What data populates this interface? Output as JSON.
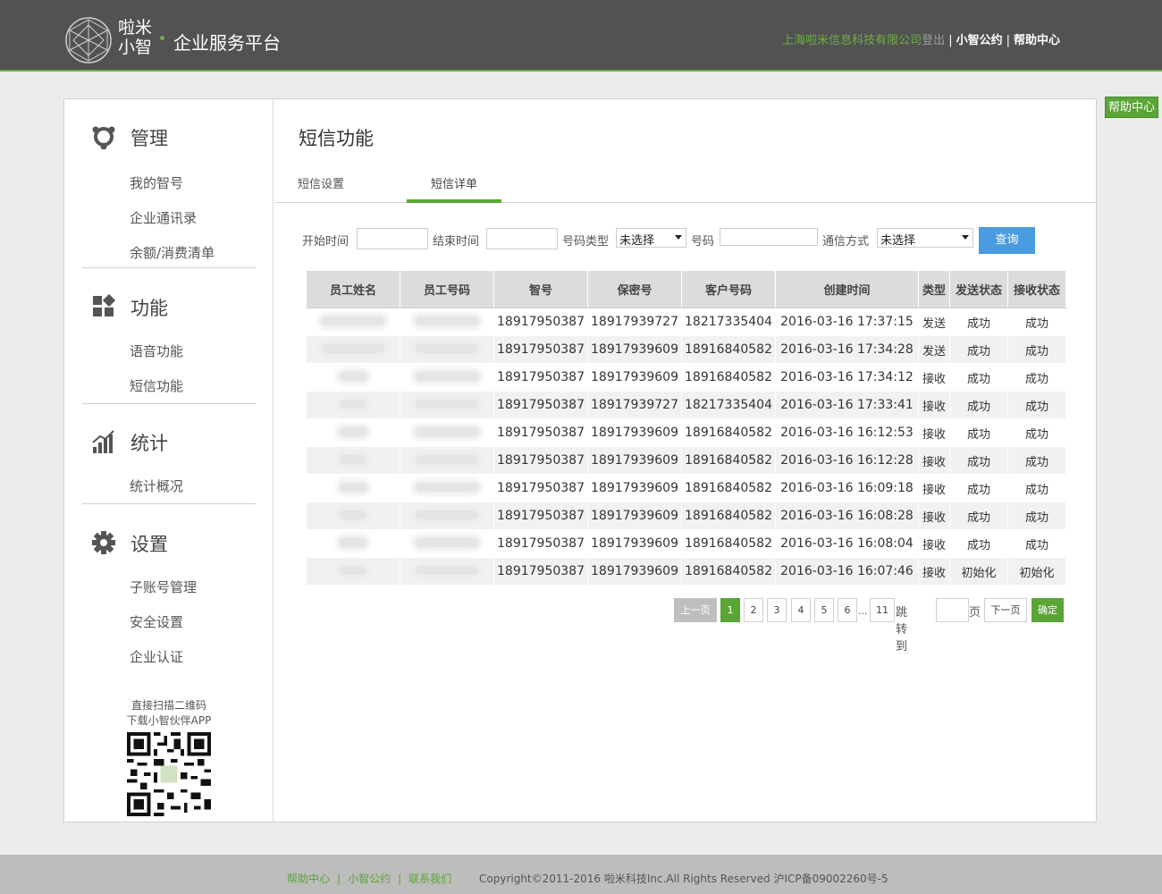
{
  "header": {
    "brand_line1": "啦米",
    "brand_line2": "小智",
    "platform": "企业服务平台",
    "company": "上海啦米信息科技有限公司",
    "logout": "登出",
    "sep": "|",
    "link_agreement": "小智公约",
    "link_help": "帮助中心",
    "accent_color": "#6fae45"
  },
  "float_help": "帮助中心",
  "sidebar": {
    "sections": [
      {
        "title": "管理",
        "icon": "manage-icon",
        "items": [
          "我的智号",
          "企业通讯录",
          "余额/消费清单"
        ]
      },
      {
        "title": "功能",
        "icon": "function-icon",
        "items": [
          "语音功能",
          "短信功能"
        ]
      },
      {
        "title": "统计",
        "icon": "stats-icon",
        "items": [
          "统计概况"
        ]
      },
      {
        "title": "设置",
        "icon": "settings-gear-icon",
        "items": [
          "子账号管理",
          "安全设置",
          "企业认证"
        ]
      }
    ],
    "qr_line1": "直接扫描二维码",
    "qr_line2": "下载小智伙伴APP"
  },
  "content": {
    "title": "短信功能",
    "tabs": [
      {
        "label": "短信设置",
        "active": false
      },
      {
        "label": "短信详单",
        "active": true
      }
    ]
  },
  "filters": {
    "start_label": "开始时间",
    "start_value": "",
    "end_label": "结束时间",
    "end_value": "",
    "num_type_label": "号码类型",
    "num_type_value": "未选择",
    "num_label": "号码",
    "num_value": "",
    "comm_label": "通信方式",
    "comm_value": "未选择",
    "query_label": "查询"
  },
  "table": {
    "columns": [
      "员工姓名",
      "员工号码",
      "智号",
      "保密号",
      "客户号码",
      "创建时间",
      "类型",
      "发送状态",
      "接收状态"
    ],
    "rows": [
      [
        "",
        "",
        "18917950387",
        "18917939727",
        "18217335404",
        "2016-03-16 17:37:15",
        "发送",
        "成功",
        "成功"
      ],
      [
        "",
        "",
        "18917950387",
        "18917939609",
        "18916840582",
        "2016-03-16 17:34:28",
        "发送",
        "成功",
        "成功"
      ],
      [
        "",
        "",
        "18917950387",
        "18917939609",
        "18916840582",
        "2016-03-16 17:34:12",
        "接收",
        "成功",
        "成功"
      ],
      [
        "",
        "",
        "18917950387",
        "18917939727",
        "18217335404",
        "2016-03-16 17:33:41",
        "接收",
        "成功",
        "成功"
      ],
      [
        "",
        "",
        "18917950387",
        "18917939609",
        "18916840582",
        "2016-03-16 16:12:53",
        "接收",
        "成功",
        "成功"
      ],
      [
        "",
        "",
        "18917950387",
        "18917939609",
        "18916840582",
        "2016-03-16 16:12:28",
        "接收",
        "成功",
        "成功"
      ],
      [
        "",
        "",
        "18917950387",
        "18917939609",
        "18916840582",
        "2016-03-16 16:09:18",
        "接收",
        "成功",
        "成功"
      ],
      [
        "",
        "",
        "18917950387",
        "18917939609",
        "18916840582",
        "2016-03-16 16:08:28",
        "接收",
        "成功",
        "成功"
      ],
      [
        "",
        "",
        "18917950387",
        "18917939609",
        "18916840582",
        "2016-03-16 16:08:04",
        "接收",
        "成功",
        "成功"
      ],
      [
        "",
        "",
        "18917950387",
        "18917939609",
        "18916840582",
        "2016-03-16 16:07:46",
        "接收",
        "初始化",
        "初始化"
      ]
    ]
  },
  "pager": {
    "prev": "上一页",
    "pages": [
      "1",
      "2",
      "3",
      "4",
      "5",
      "6"
    ],
    "ellipsis": "...",
    "last": "11",
    "current": "1",
    "jump_label": "跳转到",
    "jump_value": "",
    "page_unit": "页",
    "next": "下一页",
    "confirm": "确定"
  },
  "footer": {
    "links": [
      "帮助中心",
      "小智公约",
      "联系我们"
    ],
    "sep": "|",
    "copyright": "Copyright©2011-2016 啦米科技Inc.All Rights Reserved 沪ICP备09002260号-5"
  }
}
